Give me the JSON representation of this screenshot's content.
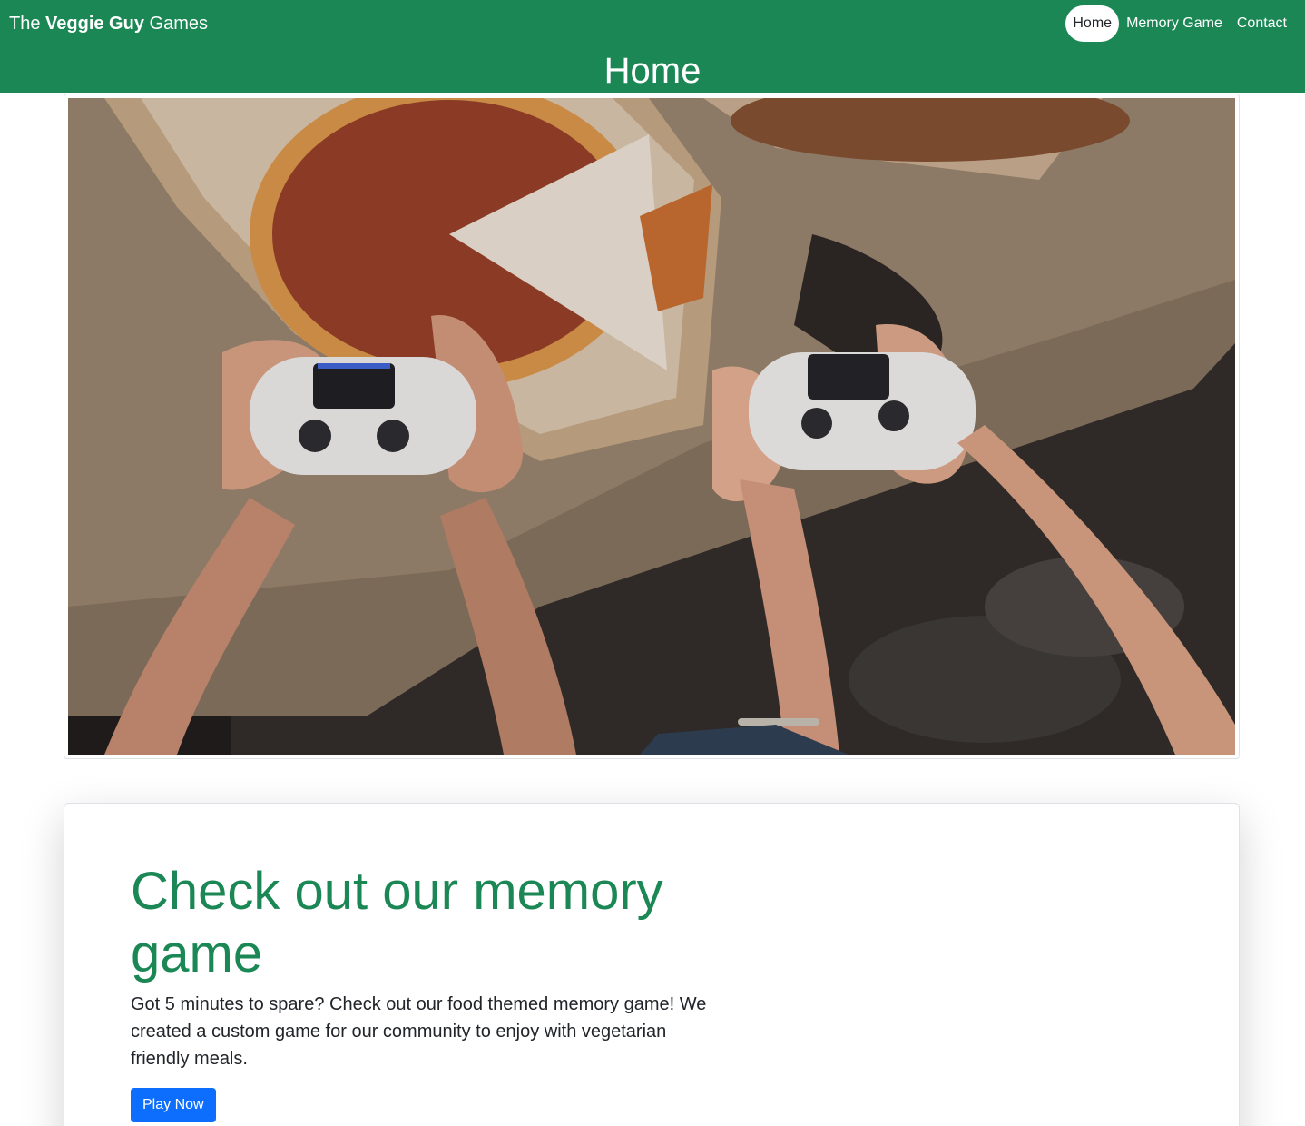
{
  "header": {
    "brand_prefix": "The ",
    "brand_bold": "Veggie Guy",
    "brand_suffix": " Games",
    "nav": [
      "Home",
      "Memory Game",
      "Contact"
    ],
    "active_nav": "Home",
    "page_title": "Home",
    "color": "#1a8755"
  },
  "hero": {
    "icon": "hero-photo"
  },
  "card": {
    "heading": "Check out our memory game",
    "text": "Got 5 minutes to spare? Check out our food themed memory game! We created a custom game for our community to enjoy with vegetarian friendly meals.",
    "button": "Play Now",
    "heading_color": "#1a8755",
    "button_color": "#0d6efd"
  }
}
